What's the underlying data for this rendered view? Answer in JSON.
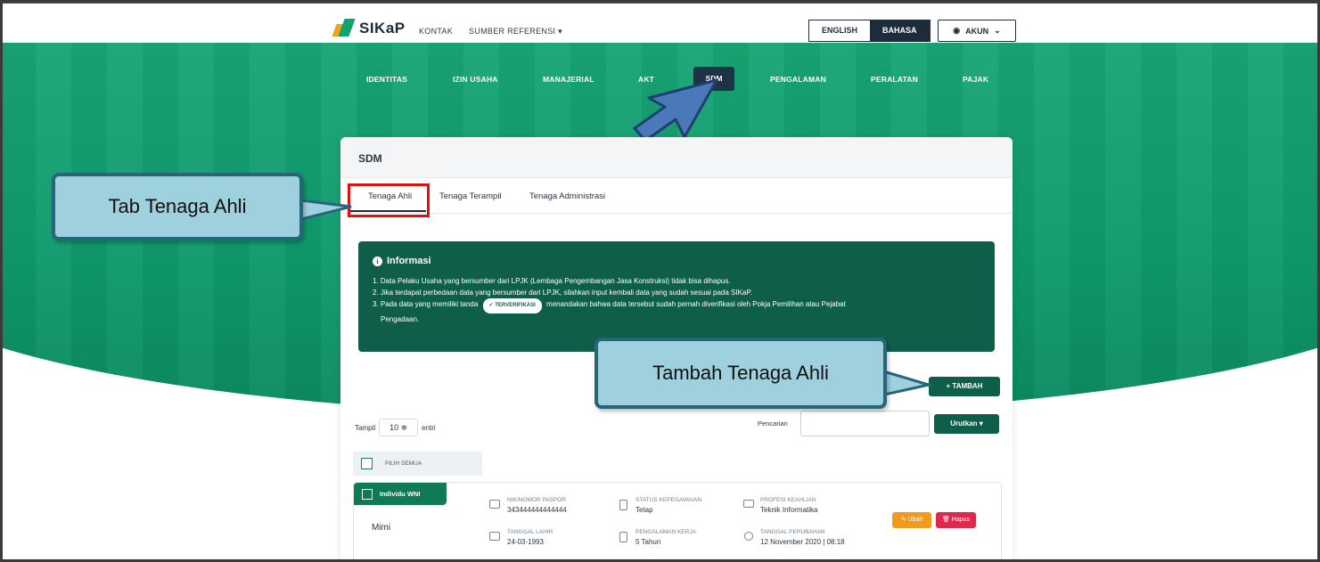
{
  "brand": {
    "name": "SIKaP"
  },
  "topnav": {
    "links": [
      "KONTAK",
      "SUMBER REFERENSI"
    ],
    "lang": {
      "english": "ENGLISH",
      "bahasa": "BAHASA"
    },
    "account": "AKUN"
  },
  "menu": {
    "items": [
      "IDENTITAS",
      "IZIN USAHA",
      "MANAJERIAL",
      "AKT",
      "SDM",
      "PENGALAMAN",
      "PERALATAN",
      "PAJAK"
    ],
    "active": "SDM"
  },
  "card": {
    "title": "SDM",
    "tabs": [
      "Tenaga Ahli",
      "Tenaga Terampil",
      "Tenaga Administrasi"
    ],
    "active_tab": "Tenaga Ahli"
  },
  "info": {
    "title": "Informasi",
    "line1": "1. Data Pelaku Usaha yang bersumber dari LPJK (Lembaga Pengembangan Jasa Konstruksi) tidak bisa dihapus.",
    "line2": "2. Jika terdapat perbedaan data yang bersumber dari LPJK, silahkan input kembali data yang sudah sesuai pada SIKaP.",
    "line3a": "3. Pada data yang memiliki tanda",
    "verified_pill": "TERVERIFIKASI",
    "line3b": "menandakan bahwa data tersebut sudah pernah diverifikasi oleh Pokja Pemilihan atau Pejabat",
    "line3c": "Pengadaan."
  },
  "actions": {
    "add": "+ TAMBAH",
    "sort": "Urutkan"
  },
  "list_controls": {
    "show_label": "Tampil",
    "show_value": "10",
    "entries_label": "entri",
    "search_label": "Pencarian",
    "select_all": "PILIH SEMUA"
  },
  "rows": [
    {
      "type": "Individu WNI",
      "name": "Mimi",
      "nik_label": "NIK/NOMOR PASPOR",
      "nik": "343444444444444",
      "birth_label": "TANGGAL LAHIR",
      "birth": "24-03-1993",
      "status_label": "STATUS KEPEGAWAIAN",
      "status": "Tetap",
      "exp_label": "PENGALAMAN KERJA",
      "exp": "5 Tahun",
      "prof_label": "PROFESI KEAHLIAN",
      "prof": "Teknik Informatika",
      "changed_label": "TANGGAL PERUBAHAN",
      "changed": "12 November 2020 | 08:18",
      "edit": "Ubah",
      "delete": "Hapus"
    }
  ],
  "callouts": {
    "tab": "Tab Tenaga Ahli",
    "add": "Tambah Tenaga Ahli"
  },
  "colors": {
    "primary": "#0f5e4a",
    "hero": "#13a070",
    "nav_dark": "#1d2b3a",
    "edit": "#f39a1c",
    "delete": "#e0284f",
    "callout": "#9fd0de"
  }
}
